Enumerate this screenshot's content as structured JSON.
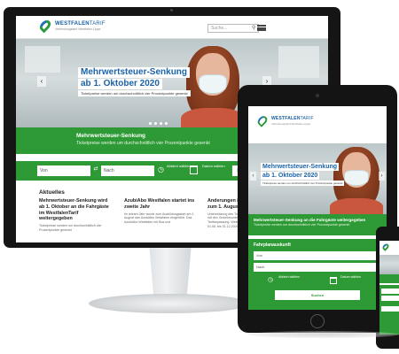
{
  "brand": {
    "name": "WESTFALEN",
    "name_suffix": "TARIF",
    "tagline": "Verbindungstarif Westfalen-Lippe"
  },
  "header": {
    "search_placeholder": "Suche..."
  },
  "hero": {
    "headline_line1": "Mehrwertsteuer-Senkung",
    "headline_line2": "ab 1. Oktober 2020",
    "subline": "Ticketpreise werden um durchschnittlich vier Prozentpunkte gesenkt"
  },
  "banner": {
    "title": "Mehrwertsteuer-Senkung",
    "subtitle": "Ticketpreise werden um durchschnittlich vier Prozentpunkte gesenkt"
  },
  "tablet_banner": {
    "title": "Mehrwertsteuer-Senkung an die Fahrgäste weitergegeben",
    "subtitle": "Ticketpreise werden um durchschnittlich vier Prozentpunkte gesenkt"
  },
  "trip_form": {
    "section_title": "Fahrplanauskunft",
    "from_placeholder": "Von",
    "to_placeholder": "Nach",
    "depart_label": "Abfahrt wählen",
    "date_label": "Datum wählen",
    "search_label": "Suchen"
  },
  "news": {
    "title": "Aktuelles",
    "articles": [
      {
        "headline": "Mehrwertsteuer-Senkung wird ab 1. Oktober an die Fahrgäste im WestfalenTarif weitergegeben",
        "teaser": "Ticketpreise werden um durchschnittlich vier Prozentpunkte gesenkt"
      },
      {
        "headline": "AzubiAbo Westfalen startet ins zweite Jahr",
        "teaser": "Im letzten Jahr wurde zum Ausbildungsstart am 1. August das AzubiAbo Westfalen eingeführt. Das AzubiAbo Westfalen mit Bus und"
      },
      {
        "headline": "Änderungen im WestfalenTarif zum 1. August 2020",
        "teaser": "Unterstützung des Ticketangebotes gemeinsam mit den Verkehrsunternehmen einen Rahmen der Tarifanpassung. Weitere Information werden ab 01.08. bis 31.12.2020"
      }
    ]
  },
  "colors": {
    "brand_green": "#2e9a36",
    "brand_blue": "#1a63a8"
  }
}
